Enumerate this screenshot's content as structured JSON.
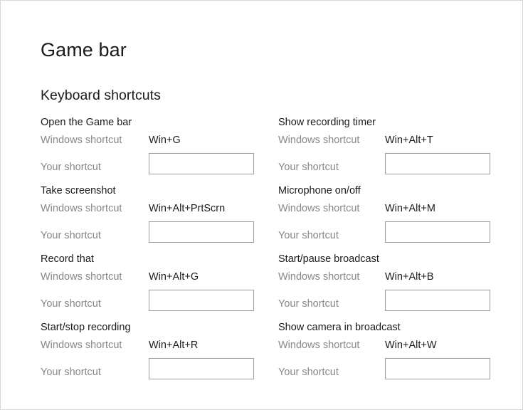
{
  "page": {
    "title": "Game bar",
    "section_title": "Keyboard shortcuts"
  },
  "labels": {
    "windows_shortcut": "Windows shortcut",
    "your_shortcut": "Your shortcut",
    "your_shortcut_placeholder": ""
  },
  "colors": {
    "text": "#1b1b1b",
    "muted_text": "#888888",
    "input_border": "#9b9b9b",
    "page_border": "#d8d8d8",
    "background": "#ffffff"
  },
  "columns": {
    "left": [
      {
        "title": "Open the Game bar",
        "windows_shortcut_label": "Windows shortcut",
        "windows_shortcut_value": "Win+G",
        "your_shortcut_label": "Your shortcut",
        "your_shortcut_value": ""
      },
      {
        "title": "Take screenshot",
        "windows_shortcut_label": "Windows shortcut",
        "windows_shortcut_value": "Win+Alt+PrtScrn",
        "your_shortcut_label": "Your shortcut",
        "your_shortcut_value": ""
      },
      {
        "title": "Record that",
        "windows_shortcut_label": "Windows shortcut",
        "windows_shortcut_value": "Win+Alt+G",
        "your_shortcut_label": "Your shortcut",
        "your_shortcut_value": ""
      },
      {
        "title": "Start/stop recording",
        "windows_shortcut_label": "Windows shortcut",
        "windows_shortcut_value": "Win+Alt+R",
        "your_shortcut_label": "Your shortcut",
        "your_shortcut_value": ""
      }
    ],
    "right": [
      {
        "title": "Show recording timer",
        "windows_shortcut_label": "Windows shortcut",
        "windows_shortcut_value": "Win+Alt+T",
        "your_shortcut_label": "Your shortcut",
        "your_shortcut_value": ""
      },
      {
        "title": "Microphone on/off",
        "windows_shortcut_label": "Windows shortcut",
        "windows_shortcut_value": "Win+Alt+M",
        "your_shortcut_label": "Your shortcut",
        "your_shortcut_value": ""
      },
      {
        "title": "Start/pause broadcast",
        "windows_shortcut_label": "Windows shortcut",
        "windows_shortcut_value": "Win+Alt+B",
        "your_shortcut_label": "Your shortcut",
        "your_shortcut_value": ""
      },
      {
        "title": "Show camera in broadcast",
        "windows_shortcut_label": "Windows shortcut",
        "windows_shortcut_value": "Win+Alt+W",
        "your_shortcut_label": "Your shortcut",
        "your_shortcut_value": ""
      }
    ]
  }
}
